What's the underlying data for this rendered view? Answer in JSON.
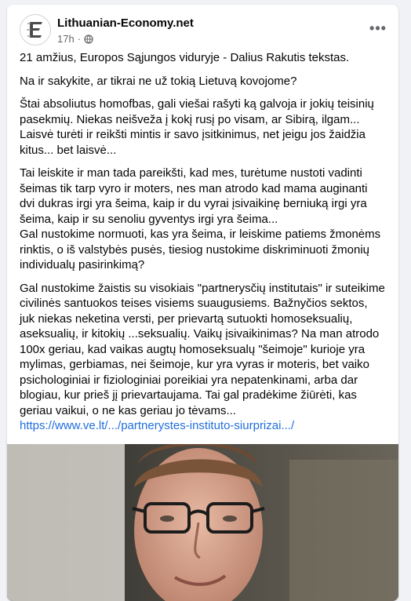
{
  "post": {
    "page_name": "Lithuanian-Economy.net",
    "time": "17h",
    "dot": "·",
    "privacy_icon": "globe-icon",
    "more_icon": "more-horizontal-icon",
    "more_label": "•••",
    "paragraphs": [
      "21 amžius, Europos Sąjungos viduryje - Dalius Rakutis tekstas.",
      "Na ir sakykite, ar tikrai ne už tokią Lietuvą kovojome?",
      "Štai absoliutus homofbas, gali viešai rašyti ką galvoja ir jokių teisinių pasekmių. Niekas neišveža į kokį rusį po visam, ar Sibirą, ilgam...\nLaisvė turėti ir reikšti mintis ir savo įsitkinimus, net jeigu jos žaidžia kitus... bet laisvė...",
      "Tai leiskite ir man tada pareikšti, kad mes, turėtume nustoti vadinti šeimas tik tarp vyro ir moters, nes man atrodo kad mama auginanti dvi dukras irgi yra šeima, kaip ir du vyrai įsivaikinę berniuką irgi yra šeima, kaip ir su senoliu gyventys irgi yra šeima...\nGal nustokime normuoti, kas yra šeima, ir leiskime patiems žmonėms rinktis, o iš valstybės pusės, tiesiog nustokime diskriminuoti žmonių individualų pasirinkimą?",
      "Gal nustokime žaistis su visokiais \"partnerysčių institutais\" ir suteikime civilinės santuokos teises visiems suaugusiems. Bažnyčios sektos, juk niekas neketina versti, per prievartą sutuokti homoseksualių, aseksualių, ir kitokių ...seksualių. Vaikų įsivaikinimas? Na man atrodo 100x geriau, kad vaikas augtų homoseksualų \"šeimoje\" kurioje yra mylimas, gerbiamas, nei šeimoje, kur yra vyras ir moteris, bet vaiko psichologiniai ir fiziologiniai poreikiai yra nepatenkinami, arba dar blogiau, kur prieš jį prievartaujama. Tai gal pradėkime žiūrėti, kas geriau vaikui, o ne kas geriau jo tėvams..."
    ],
    "link": "https://www.ve.lt/.../partnerystes-instituto-siurprizai.../"
  },
  "colors": {
    "link": "#216fdb",
    "meta": "#65676b",
    "background": "#f0f2f5",
    "card": "#ffffff"
  }
}
